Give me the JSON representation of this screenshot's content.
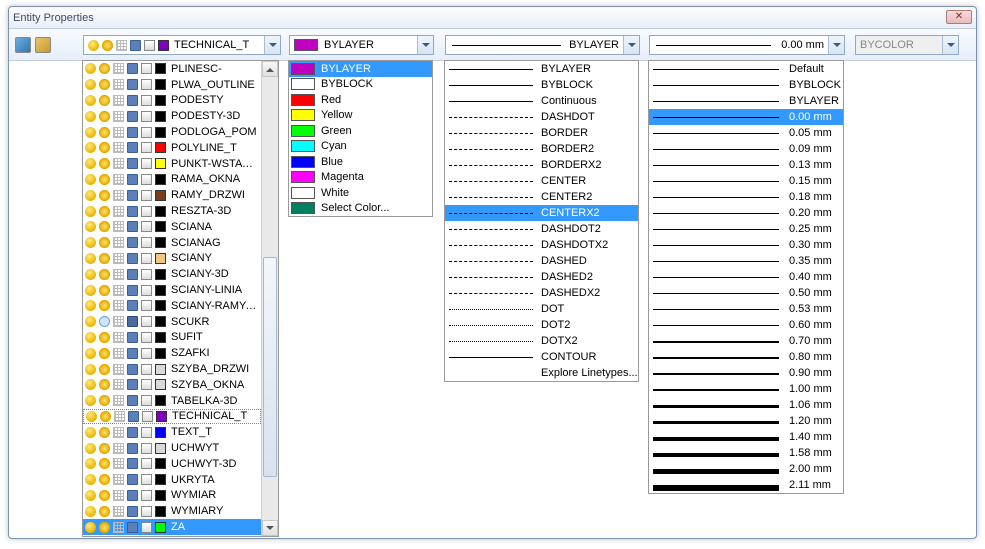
{
  "window_title": "Entity Properties",
  "toolbar": {
    "layer_value": "TECHNICAL_T",
    "color_value": "BYLAYER",
    "linetype_value": "BYLAYER",
    "lineweight_value": "0.00 mm",
    "bycolor_value": "BYCOLOR"
  },
  "layer_list": [
    {
      "name": "PLINESC-",
      "color": "#000000"
    },
    {
      "name": "PLWA_OUTLINE",
      "color": "#000000"
    },
    {
      "name": "PODESTY",
      "color": "#000000"
    },
    {
      "name": "PODESTY-3D",
      "color": "#000000"
    },
    {
      "name": "PODLOGA_POM",
      "color": "#000000"
    },
    {
      "name": "POLYLINE_T",
      "color": "#ff0000"
    },
    {
      "name": "PUNKT-WSTAWIANIA",
      "color": "#ffff00"
    },
    {
      "name": "RAMA_OKNA",
      "color": "#000000"
    },
    {
      "name": "RAMY_DRZWI",
      "color": "#7a3b1e"
    },
    {
      "name": "RESZTA-3D",
      "color": "#000000"
    },
    {
      "name": "SCIANA",
      "color": "#000000"
    },
    {
      "name": "SCIANAG",
      "color": "#000000"
    },
    {
      "name": "SCIANY",
      "color": "#f4c486"
    },
    {
      "name": "SCIANY-3D",
      "color": "#000000"
    },
    {
      "name": "SCIANY-LINIA",
      "color": "#000000"
    },
    {
      "name": "SCIANY-RAMY-OKIEN",
      "color": "#000000"
    },
    {
      "name": "SCUKR",
      "color": "#000000",
      "frozen": true,
      "locked": true
    },
    {
      "name": "SUFIT",
      "color": "#000000"
    },
    {
      "name": "SZAFKI",
      "color": "#000000"
    },
    {
      "name": "SZYBA_DRZWI",
      "color": "#d9d9d9"
    },
    {
      "name": "SZYBA_OKNA",
      "color": "#d9d9d9"
    },
    {
      "name": "TABELKA-3D",
      "color": "#000000"
    },
    {
      "name": "TECHNICAL_T",
      "color": "#8000c0",
      "bordered": true
    },
    {
      "name": "TEXT_T",
      "color": "#0000ff"
    },
    {
      "name": "UCHWYT",
      "color": "#d9d9d9"
    },
    {
      "name": "UCHWYT-3D",
      "color": "#000000"
    },
    {
      "name": "UKRYTA",
      "color": "#000000"
    },
    {
      "name": "WYMIAR",
      "color": "#000000"
    },
    {
      "name": "WYMIARY",
      "color": "#000000"
    },
    {
      "name": "ZA",
      "color": "#00ff00",
      "selected": true
    }
  ],
  "color_list": [
    {
      "label": "BYLAYER",
      "color": "#c000c0",
      "selected": true
    },
    {
      "label": "BYBLOCK",
      "color": "#ffffff"
    },
    {
      "label": "Red",
      "color": "#ff0000"
    },
    {
      "label": "Yellow",
      "color": "#ffff00"
    },
    {
      "label": "Green",
      "color": "#00ff00"
    },
    {
      "label": "Cyan",
      "color": "#00ffff"
    },
    {
      "label": "Blue",
      "color": "#0000ff"
    },
    {
      "label": "Magenta",
      "color": "#ff00ff"
    },
    {
      "label": "White",
      "color": "#ffffff"
    },
    {
      "label": "Select Color...",
      "color": "#008060"
    }
  ],
  "linetype_list": [
    {
      "label": "BYLAYER",
      "style": "solid"
    },
    {
      "label": "BYBLOCK",
      "style": "solid"
    },
    {
      "label": "Continuous",
      "style": "solid"
    },
    {
      "label": "DASHDOT",
      "style": "dashdot"
    },
    {
      "label": "BORDER",
      "style": "dash"
    },
    {
      "label": "BORDER2",
      "style": "dash"
    },
    {
      "label": "BORDERX2",
      "style": "dash"
    },
    {
      "label": "CENTER",
      "style": "dashdot"
    },
    {
      "label": "CENTER2",
      "style": "dashdot"
    },
    {
      "label": "CENTERX2",
      "style": "dashdot",
      "selected": true
    },
    {
      "label": "DASHDOT2",
      "style": "dashdot"
    },
    {
      "label": "DASHDOTX2",
      "style": "dashdot"
    },
    {
      "label": "DASHED",
      "style": "dash"
    },
    {
      "label": "DASHED2",
      "style": "dash"
    },
    {
      "label": "DASHEDX2",
      "style": "dash"
    },
    {
      "label": "DOT",
      "style": "dot"
    },
    {
      "label": "DOT2",
      "style": "dot"
    },
    {
      "label": "DOTX2",
      "style": "dot"
    },
    {
      "label": "CONTOUR",
      "style": "solid"
    },
    {
      "label": "Explore Linetypes...",
      "style": "none"
    }
  ],
  "lineweight_list": [
    {
      "label": "Default",
      "w": 1
    },
    {
      "label": "BYBLOCK",
      "w": 1
    },
    {
      "label": "BYLAYER",
      "w": 1
    },
    {
      "label": "0.00 mm",
      "w": 1,
      "selected": true
    },
    {
      "label": "0.05 mm",
      "w": 1
    },
    {
      "label": "0.09 mm",
      "w": 1
    },
    {
      "label": "0.13 mm",
      "w": 1
    },
    {
      "label": "0.15 mm",
      "w": 1
    },
    {
      "label": "0.18 mm",
      "w": 1
    },
    {
      "label": "0.20 mm",
      "w": 1
    },
    {
      "label": "0.25 mm",
      "w": 1
    },
    {
      "label": "0.30 mm",
      "w": 1
    },
    {
      "label": "0.35 mm",
      "w": 1
    },
    {
      "label": "0.40 mm",
      "w": 1
    },
    {
      "label": "0.50 mm",
      "w": 1
    },
    {
      "label": "0.53 mm",
      "w": 1
    },
    {
      "label": "0.60 mm",
      "w": 1
    },
    {
      "label": "0.70 mm",
      "w": 2
    },
    {
      "label": "0.80 mm",
      "w": 2
    },
    {
      "label": "0.90 mm",
      "w": 2
    },
    {
      "label": "1.00 mm",
      "w": 2
    },
    {
      "label": "1.06 mm",
      "w": 3
    },
    {
      "label": "1.20 mm",
      "w": 3
    },
    {
      "label": "1.40 mm",
      "w": 4
    },
    {
      "label": "1.58 mm",
      "w": 4
    },
    {
      "label": "2.00 mm",
      "w": 5
    },
    {
      "label": "2.11 mm",
      "w": 6
    }
  ]
}
